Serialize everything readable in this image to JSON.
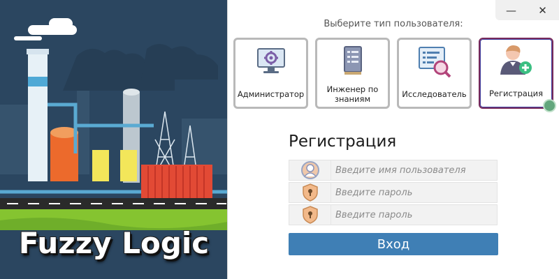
{
  "window": {
    "minimize_icon": "minimize-icon",
    "close_icon": "close-icon",
    "minimize_glyph": "—",
    "close_glyph": "✕"
  },
  "hero": {
    "title": "Fuzzy Logic",
    "image": "industrial-factory-illustration"
  },
  "user_type": {
    "label": "Выберите тип пользователя:",
    "roles": [
      {
        "label": "Администратор",
        "icon": "admin-monitor-gear-icon",
        "selected": false
      },
      {
        "label": "Инженер по знаниям",
        "icon": "knowledge-book-icon",
        "selected": false
      },
      {
        "label": "Исследователь",
        "icon": "researcher-magnifier-icon",
        "selected": false
      },
      {
        "label": "Регистрация",
        "icon": "add-user-icon",
        "selected": true
      }
    ]
  },
  "form": {
    "title": "Регистрация",
    "username_placeholder": "Введите имя пользователя",
    "password_placeholder": "Введите пароль",
    "password_confirm_placeholder": "Введите пароль",
    "username_icon": "user-avatar-icon",
    "password_icon": "lock-shield-icon",
    "submit_label": "Вход"
  },
  "colors": {
    "accent": "#3f7fb5",
    "selected_border": "#7a2c5c",
    "hero_bg": "#2d4660"
  }
}
